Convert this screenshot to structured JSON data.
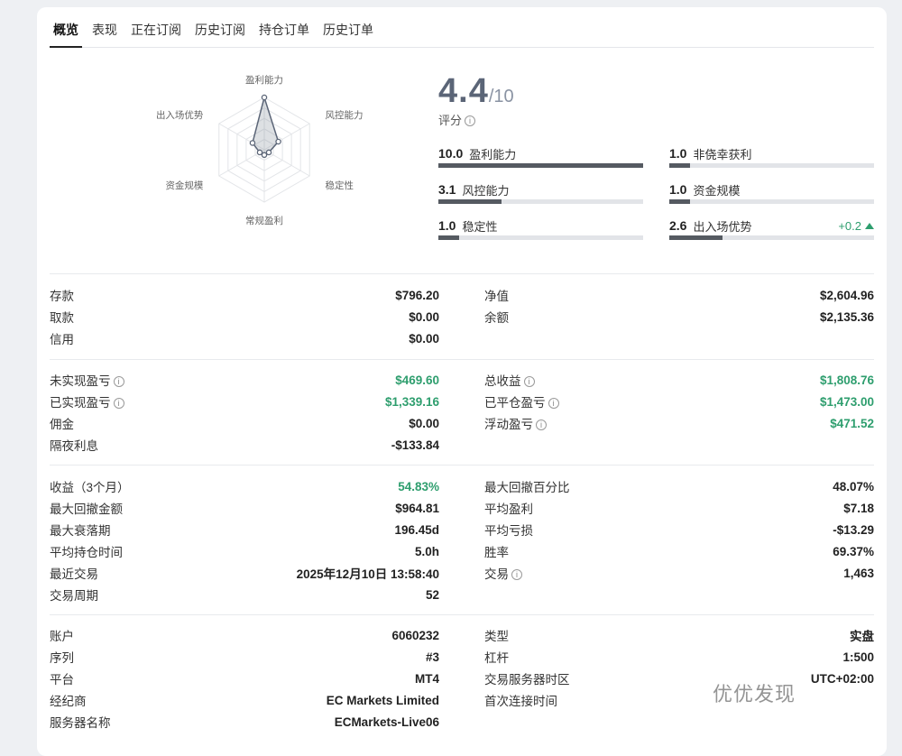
{
  "tabs": [
    "概览",
    "表现",
    "正在订阅",
    "历史订阅",
    "持仓订单",
    "历史订单"
  ],
  "radar": {
    "labels": [
      "盈利能力",
      "风控能力",
      "稳定性",
      "常规盈利",
      "资金规模",
      "出入场优势"
    ],
    "values": [
      10.0,
      3.1,
      1.0,
      1.0,
      1.0,
      2.6
    ]
  },
  "score": {
    "value": "4.4",
    "denominator": "/10",
    "label": "评分"
  },
  "bars": [
    {
      "value": "10.0",
      "label": "盈利能力",
      "level": 1.0
    },
    {
      "value": "1.0",
      "label": "非侥幸获利",
      "level": 0.1
    },
    {
      "value": "3.1",
      "label": "风控能力",
      "level": 0.31
    },
    {
      "value": "1.0",
      "label": "资金规模",
      "level": 0.1
    },
    {
      "value": "1.0",
      "label": "稳定性",
      "level": 0.1
    },
    {
      "value": "2.6",
      "label": "出入场优势",
      "level": 0.26,
      "delta": "+0.2"
    }
  ],
  "sections": {
    "funds_left": [
      {
        "k": "存款",
        "v": "$796.20"
      },
      {
        "k": "取款",
        "v": "$0.00"
      },
      {
        "k": "信用",
        "v": "$0.00"
      }
    ],
    "funds_right": [
      {
        "k": "净值",
        "v": "$2,604.96"
      },
      {
        "k": "余额",
        "v": "$2,135.36"
      }
    ],
    "pnl_left": [
      {
        "k": "未实现盈亏",
        "v": "$469.60",
        "info": true,
        "green": true
      },
      {
        "k": "已实现盈亏",
        "v": "$1,339.16",
        "info": true,
        "green": true
      },
      {
        "k": "佣金",
        "v": "$0.00"
      },
      {
        "k": "隔夜利息",
        "v": "-$133.84"
      }
    ],
    "pnl_right": [
      {
        "k": "总收益",
        "v": "$1,808.76",
        "info": true,
        "green": true
      },
      {
        "k": "已平仓盈亏",
        "v": "$1,473.00",
        "info": true,
        "green": true
      },
      {
        "k": "浮动盈亏",
        "v": "$471.52",
        "info": true,
        "green": true
      }
    ],
    "stats_left": [
      {
        "k": "收益（3个月）",
        "v": "54.83%",
        "green": true
      },
      {
        "k": "最大回撤金额",
        "v": "$964.81"
      },
      {
        "k": "最大衰落期",
        "v": "196.45d"
      },
      {
        "k": "平均持仓时间",
        "v": "5.0h"
      },
      {
        "k": "最近交易",
        "v": "2025年12月10日 13:58:40"
      },
      {
        "k": "交易周期",
        "v": "52"
      }
    ],
    "stats_right": [
      {
        "k": "最大回撤百分比",
        "v": "48.07%"
      },
      {
        "k": "平均盈利",
        "v": "$7.18"
      },
      {
        "k": "平均亏损",
        "v": "-$13.29"
      },
      {
        "k": "胜率",
        "v": "69.37%"
      },
      {
        "k": "交易",
        "v": "1,463",
        "info": true
      }
    ],
    "account_left": [
      {
        "k": "账户",
        "v": "6060232"
      },
      {
        "k": "序列",
        "v": "#3"
      },
      {
        "k": "平台",
        "v": "MT4"
      },
      {
        "k": "经纪商",
        "v": "EC Markets Limited"
      },
      {
        "k": "服务器名称",
        "v": "ECMarkets-Live06"
      }
    ],
    "account_right": [
      {
        "k": "类型",
        "v": "实盘"
      },
      {
        "k": "杠杆",
        "v": "1:500"
      },
      {
        "k": "交易服务器时区",
        "v": "UTC+02:00"
      },
      {
        "k": "首次连接时间",
        "v": ""
      }
    ]
  },
  "watermark": "优优发现",
  "colors": {
    "green": "#2e9e6e",
    "bar_fill": "#555a61",
    "score": "#5b6577"
  }
}
